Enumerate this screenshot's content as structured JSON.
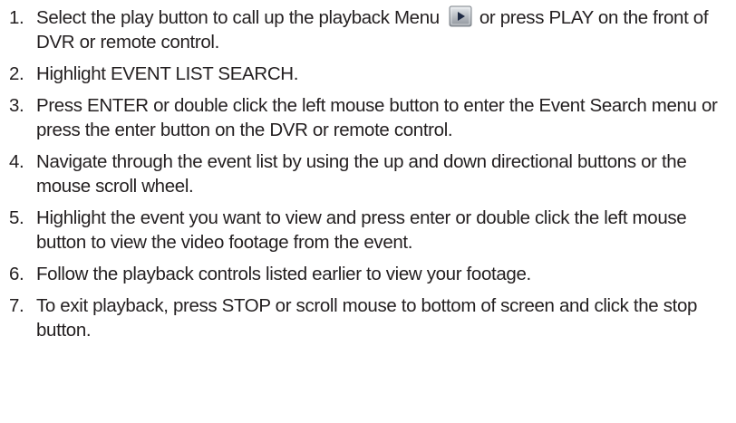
{
  "steps": [
    {
      "number": "1.",
      "text_before_icon": "Select the play button to call up the playback Menu",
      "icon": "play-button-icon",
      "text_after_icon": "or press PLAY on the front of DVR or remote control."
    },
    {
      "number": "2.",
      "text": "Highlight EVENT LIST SEARCH."
    },
    {
      "number": "3.",
      "text": "Press ENTER or double click the left mouse button to enter the Event Search menu or press the enter button on the DVR or remote control."
    },
    {
      "number": "4.",
      "text": "Navigate through the event list by using the up and down directional buttons or the mouse scroll wheel."
    },
    {
      "number": "5.",
      "text": "Highlight the event you want to view and press enter or double click the left mouse button to view the video footage from the event."
    },
    {
      "number": "6.",
      "text": "Follow the playback controls listed earlier to view your footage."
    },
    {
      "number": "7.",
      "text": "To exit playback, press STOP or scroll mouse to bottom of screen and click the stop button."
    }
  ]
}
